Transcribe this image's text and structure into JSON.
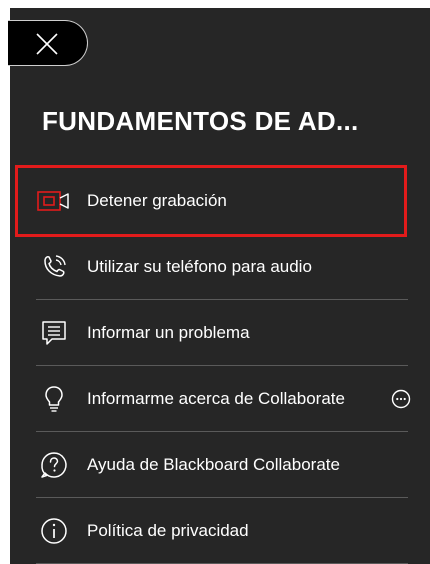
{
  "panel": {
    "title": "FUNDAMENTOS DE AD...",
    "close_icon": "close-icon"
  },
  "menu": {
    "items": [
      {
        "label": "Detener grabación",
        "icon": "record-icon",
        "highlighted": true
      },
      {
        "label": "Utilizar su teléfono para audio",
        "icon": "phone-icon"
      },
      {
        "label": "Informar un problema",
        "icon": "report-icon"
      },
      {
        "label": "Informarme acerca de Collaborate",
        "icon": "lightbulb-icon",
        "more_icon": "more-icon"
      },
      {
        "label": "Ayuda de Blackboard Collaborate",
        "icon": "help-icon"
      },
      {
        "label": "Política de privacidad",
        "icon": "info-icon"
      }
    ]
  },
  "colors": {
    "panel_background": "#262626",
    "highlight_border": "#e21b1b",
    "record_icon": "#e21b1b",
    "divider": "#5a5a5a",
    "text": "#ffffff"
  }
}
